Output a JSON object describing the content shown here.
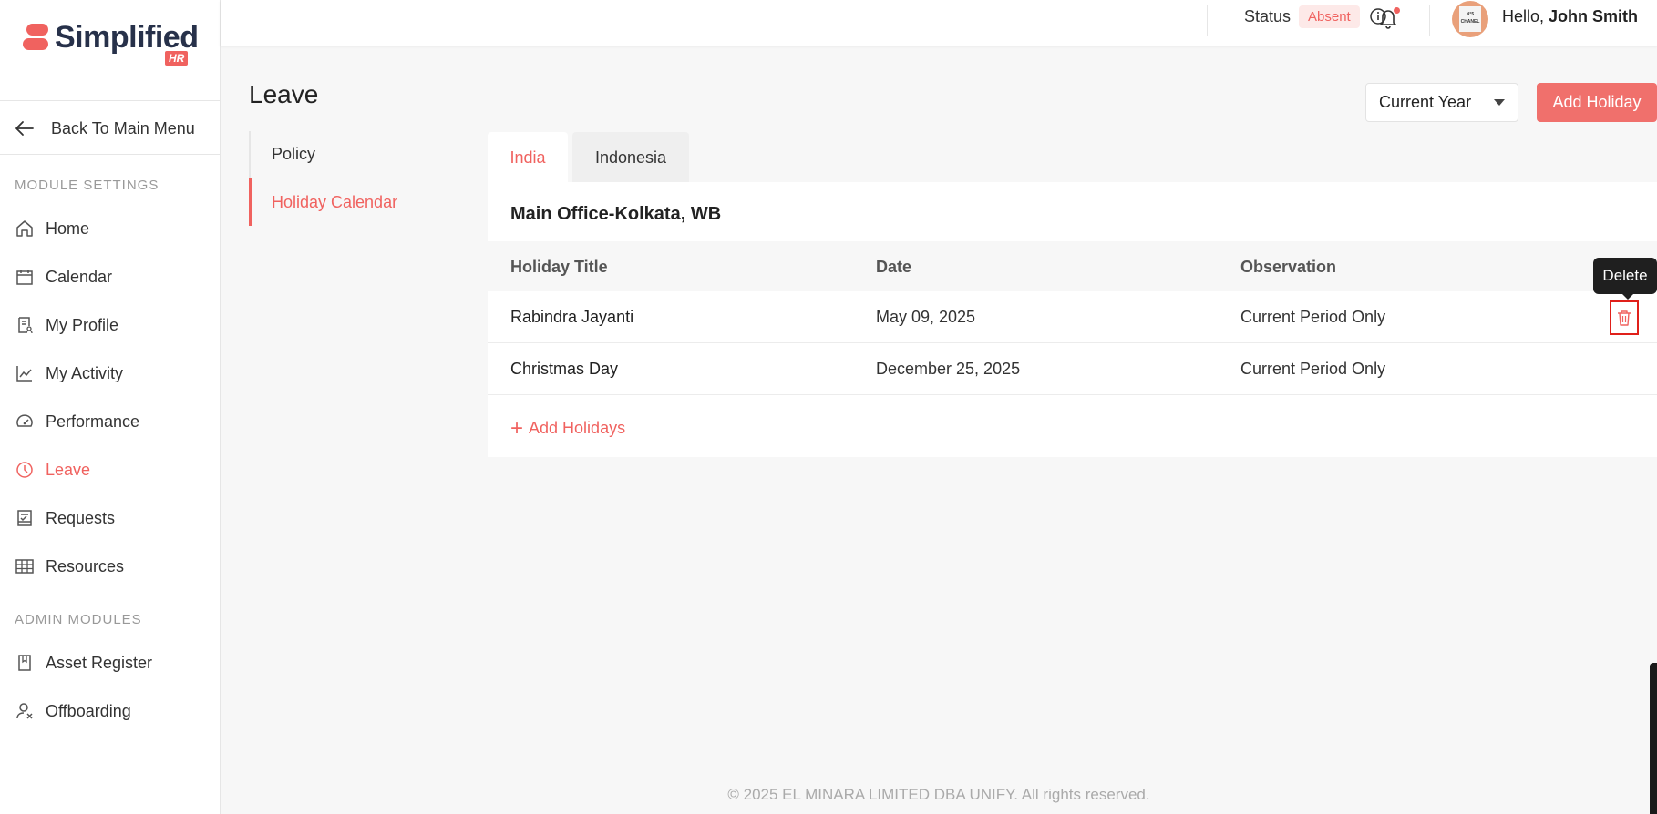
{
  "brand": {
    "name": "Simplified",
    "suffix": "HR",
    "accent": "#f0625f"
  },
  "sidebar": {
    "back_label": "Back To Main Menu",
    "module_settings_label": "MODULE SETTINGS",
    "admin_modules_label": "ADMIN MODULES",
    "items": [
      {
        "label": "Home",
        "icon": "home-icon"
      },
      {
        "label": "Calendar",
        "icon": "calendar-icon"
      },
      {
        "label": "My Profile",
        "icon": "profile-icon"
      },
      {
        "label": "My Activity",
        "icon": "activity-icon"
      },
      {
        "label": "Performance",
        "icon": "gauge-icon"
      },
      {
        "label": "Leave",
        "icon": "clock-icon",
        "active": true
      },
      {
        "label": "Requests",
        "icon": "requests-icon"
      },
      {
        "label": "Resources",
        "icon": "table-icon"
      }
    ],
    "admin_items": [
      {
        "label": "Asset Register",
        "icon": "book-icon"
      },
      {
        "label": "Offboarding",
        "icon": "offboarding-icon"
      }
    ]
  },
  "header": {
    "status_label": "Status",
    "status_value": "Absent",
    "hello_prefix": "Hello, ",
    "user_name": "John Smith",
    "avatar_text": "N°5 CHANEL"
  },
  "page": {
    "title": "Leave",
    "subnav": [
      {
        "label": "Policy"
      },
      {
        "label": "Holiday Calendar",
        "active": true
      }
    ],
    "year_filter": "Current Year",
    "add_holiday_label": "Add Holiday",
    "tabs": [
      {
        "label": "India",
        "active": true
      },
      {
        "label": "Indonesia"
      }
    ],
    "office_title": "Main Office-Kolkata, WB",
    "columns": [
      "Holiday Title",
      "Date",
      "Observation"
    ],
    "rows": [
      {
        "title": "Rabindra Jayanti",
        "date": "May 09, 2025",
        "observation": "Current Period Only"
      },
      {
        "title": "Christmas Day",
        "date": "December 25, 2025",
        "observation": "Current Period Only"
      }
    ],
    "add_holidays_label": "Add Holidays",
    "tooltip": "Delete"
  },
  "footer": {
    "text": "© 2025 EL MINARA LIMITED DBA UNIFY. All rights reserved."
  }
}
